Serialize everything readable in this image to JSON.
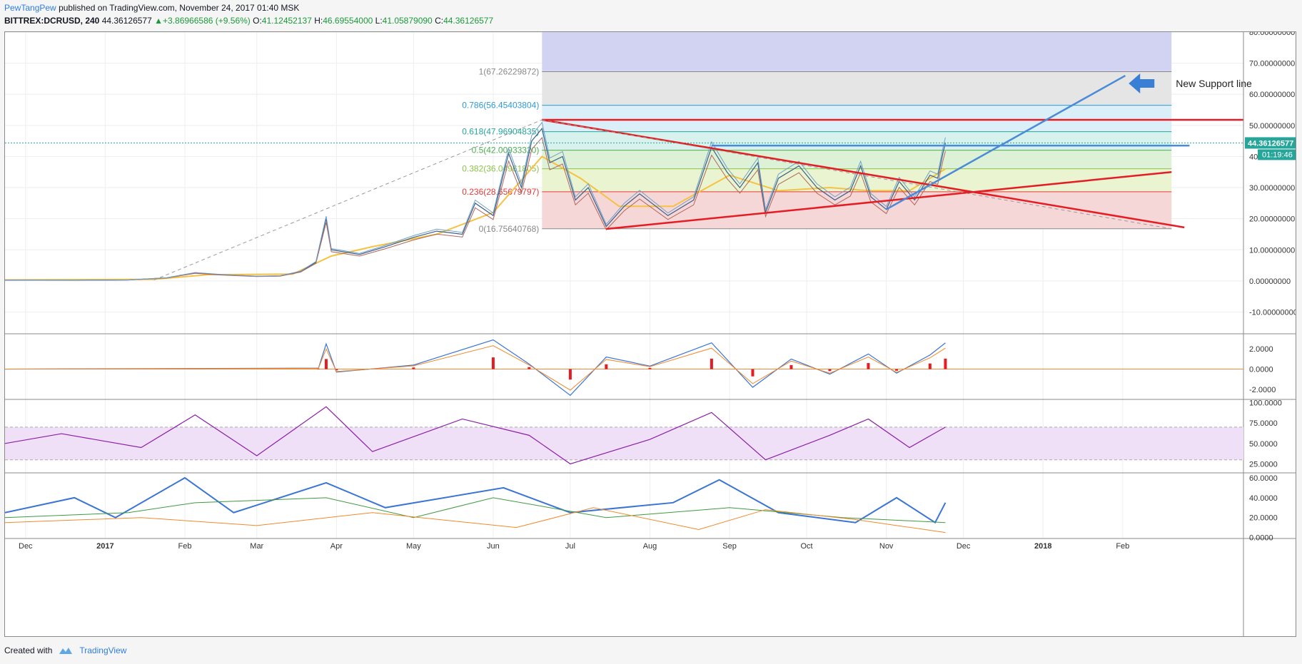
{
  "header": {
    "author": "PewTangPew",
    "published": "published on TradingView.com, November 24, 2017 01:40 MSK"
  },
  "ohlc": {
    "symbol": "BITTREX:DCRUSD, 240",
    "last": "44.36126577",
    "change": "+3.86966586 (+9.56%)",
    "o_label": "O:",
    "o": "41.12452137",
    "h_label": "H:",
    "h": "46.69554000",
    "l_label": "L:",
    "l": "41.05879090",
    "c_label": "C:",
    "c": "44.36126577"
  },
  "footer": {
    "created": "Created with",
    "brand": "TradingView"
  },
  "chart_data": {
    "type": "line",
    "colors": {
      "candles_up": "#6fa0c8",
      "candles_down": "#b0675c",
      "ma_fast": "#f5c242",
      "resistance": "#e51c23",
      "support_new": "#4a8ad8",
      "fib_top": "#6a6ad0"
    },
    "x_axis": {
      "ticks": [
        "Dec",
        "2017",
        "Feb",
        "Mar",
        "Apr",
        "May",
        "Jun",
        "Jul",
        "Aug",
        "Sep",
        "Oct",
        "Nov",
        "Dec",
        "2018",
        "Feb"
      ],
      "tick_dates": [
        "2016-12-01",
        "2017-01-01",
        "2017-02-01",
        "2017-03-01",
        "2017-04-01",
        "2017-05-01",
        "2017-06-01",
        "2017-07-01",
        "2017-08-01",
        "2017-09-01",
        "2017-10-01",
        "2017-11-01",
        "2017-12-01",
        "2018-01-01",
        "2018-02-01"
      ],
      "range": [
        "2016-11-23",
        "2018-03-20"
      ]
    },
    "price_pane": {
      "ylim": [
        -17,
        80
      ],
      "y_ticks": [
        "80.00000000",
        "70.00000000",
        "60.00000000",
        "50.00000000",
        "40.00000000",
        "30.00000000",
        "20.00000000",
        "10.00000000",
        "0.00000000",
        "-10.00000000"
      ],
      "y_tick_values": [
        80,
        70,
        60,
        50,
        40,
        30,
        20,
        10,
        0,
        -10
      ],
      "last_price": 44.36126577,
      "last_price_label": "44.36126577",
      "countdown": "01:19:46",
      "price_series": [
        [
          "2016-11-23",
          0.25
        ],
        [
          "2016-12-20",
          0.2
        ],
        [
          "2017-01-10",
          0.3
        ],
        [
          "2017-01-25",
          1.0
        ],
        [
          "2017-02-05",
          2.6
        ],
        [
          "2017-02-15",
          2.0
        ],
        [
          "2017-03-01",
          1.5
        ],
        [
          "2017-03-10",
          1.6
        ],
        [
          "2017-03-18",
          3.0
        ],
        [
          "2017-03-24",
          6.0
        ],
        [
          "2017-03-28",
          20.0
        ],
        [
          "2017-03-30",
          10.0
        ],
        [
          "2017-04-10",
          8.5
        ],
        [
          "2017-04-20",
          11.0
        ],
        [
          "2017-05-01",
          14.0
        ],
        [
          "2017-05-10",
          16.0
        ],
        [
          "2017-05-20",
          15.0
        ],
        [
          "2017-05-25",
          25.0
        ],
        [
          "2017-06-01",
          21.0
        ],
        [
          "2017-06-07",
          41.0
        ],
        [
          "2017-06-12",
          30.0
        ],
        [
          "2017-06-16",
          45.0
        ],
        [
          "2017-06-20",
          49.0
        ],
        [
          "2017-06-23",
          38.0
        ],
        [
          "2017-06-28",
          40.0
        ],
        [
          "2017-07-03",
          26.0
        ],
        [
          "2017-07-08",
          30.0
        ],
        [
          "2017-07-15",
          17.5
        ],
        [
          "2017-07-22",
          24.0
        ],
        [
          "2017-07-28",
          28.0
        ],
        [
          "2017-08-08",
          21.0
        ],
        [
          "2017-08-18",
          26.0
        ],
        [
          "2017-08-25",
          43.0
        ],
        [
          "2017-08-31",
          35.0
        ],
        [
          "2017-09-05",
          30.0
        ],
        [
          "2017-09-12",
          38.0
        ],
        [
          "2017-09-15",
          22.0
        ],
        [
          "2017-09-20",
          33.0
        ],
        [
          "2017-09-28",
          37.0
        ],
        [
          "2017-10-05",
          30.0
        ],
        [
          "2017-10-12",
          26.0
        ],
        [
          "2017-10-18",
          29.0
        ],
        [
          "2017-10-22",
          37.0
        ],
        [
          "2017-10-26",
          27.0
        ],
        [
          "2017-11-01",
          23.0
        ],
        [
          "2017-11-06",
          32.0
        ],
        [
          "2017-11-12",
          26.0
        ],
        [
          "2017-11-18",
          34.0
        ],
        [
          "2017-11-21",
          33.0
        ],
        [
          "2017-11-23",
          41.0
        ],
        [
          "2017-11-24",
          44.36
        ]
      ],
      "moving_average": [
        [
          "2016-11-23",
          0.3
        ],
        [
          "2017-01-20",
          0.5
        ],
        [
          "2017-02-10",
          2.0
        ],
        [
          "2017-03-15",
          2.2
        ],
        [
          "2017-03-30",
          8.0
        ],
        [
          "2017-04-15",
          11.0
        ],
        [
          "2017-05-10",
          15.0
        ],
        [
          "2017-06-01",
          22.0
        ],
        [
          "2017-06-20",
          40.0
        ],
        [
          "2017-07-05",
          33.0
        ],
        [
          "2017-07-20",
          24.0
        ],
        [
          "2017-08-10",
          24.0
        ],
        [
          "2017-09-01",
          34.0
        ],
        [
          "2017-09-20",
          29.0
        ],
        [
          "2017-10-10",
          30.0
        ],
        [
          "2017-10-25",
          29.0
        ],
        [
          "2017-11-10",
          29.0
        ],
        [
          "2017-11-24",
          36.0
        ]
      ],
      "fibonacci": {
        "start": "2017-06-20",
        "end": "2018-02-20",
        "levels": [
          {
            "label": "1(67.26229872)",
            "value": 67.26229872,
            "color": "#888888"
          },
          {
            "label": "0.786(56.45403804)",
            "value": 56.45403804,
            "color": "#2e9bd6"
          },
          {
            "label": "0.618(47.96904835)",
            "value": 47.96904835,
            "color": "#26a69a"
          },
          {
            "label": "0.5(42.00933320)",
            "value": 42.0093332,
            "color": "#4caf50"
          },
          {
            "label": "0.382(36.04961805)",
            "value": 36.04961805,
            "color": "#8bc34a"
          },
          {
            "label": "0.236(28.65679797)",
            "value": 28.65679797,
            "color": "#e53935"
          },
          {
            "label": "0(16.75640768)",
            "value": 16.75640768,
            "color": "#888888"
          }
        ],
        "zones": [
          {
            "from": 67.26229872,
            "to": 80,
            "color": "#d0d0f2"
          },
          {
            "from": 56.45403804,
            "to": 67.26229872,
            "color": "#e4e4e4"
          },
          {
            "from": 47.96904835,
            "to": 56.45403804,
            "color": "#d8eef8"
          },
          {
            "from": 42.0093332,
            "to": 47.96904835,
            "color": "#d5f1ec"
          },
          {
            "from": 36.04961805,
            "to": 42.0093332,
            "color": "#dbf0d4"
          },
          {
            "from": 28.65679797,
            "to": 36.04961805,
            "color": "#e9f3cf"
          },
          {
            "from": 16.75640768,
            "to": 28.65679797,
            "color": "#f5d5d5"
          }
        ]
      },
      "trendlines": [
        {
          "kind": "horizontal-resistance",
          "color": "#e51c23",
          "from": [
            "2017-06-20",
            51.8
          ],
          "to": [
            "2018-03-20",
            51.8
          ]
        },
        {
          "kind": "descending",
          "color": "#e51c23",
          "from": [
            "2017-06-20",
            51.8
          ],
          "to": [
            "2018-02-25",
            17.2
          ]
        },
        {
          "kind": "ascending-support",
          "color": "#e51c23",
          "from": [
            "2017-07-15",
            16.7
          ],
          "to": [
            "2018-02-20",
            35.0
          ]
        },
        {
          "kind": "new-support",
          "color": "#4a8ad8",
          "from": [
            "2017-11-01",
            23.0
          ],
          "to": [
            "2018-02-02",
            66.0
          ]
        },
        {
          "kind": "blue-horizontal",
          "color": "#4a8ad8",
          "from": [
            "2017-08-25",
            43.5
          ],
          "to": [
            "2018-02-27",
            43.5
          ]
        },
        {
          "kind": "dashed-grey",
          "color": "#999999",
          "from": [
            "2017-01-20",
            0.3
          ],
          "to": [
            "2017-06-20",
            51.8
          ]
        },
        {
          "kind": "dashed-grey",
          "color": "#999999",
          "from": [
            "2017-06-20",
            51.8
          ],
          "to": [
            "2018-02-20",
            16.75
          ]
        }
      ],
      "annotation": {
        "text": "New Support line",
        "arrow_at": [
          "2018-02-05",
          63.5
        ]
      }
    },
    "macd_pane": {
      "ylim": [
        -3,
        3.5
      ],
      "y_ticks": [
        "2.0000",
        "0.0000",
        "-2.0000"
      ],
      "y_tick_values": [
        2,
        0,
        -2
      ],
      "series": [
        [
          "2016-11-23",
          0.0
        ],
        [
          "2017-03-25",
          0.1
        ],
        [
          "2017-03-28",
          2.5
        ],
        [
          "2017-04-01",
          -0.3
        ],
        [
          "2017-05-01",
          0.4
        ],
        [
          "2017-06-01",
          2.9
        ],
        [
          "2017-06-15",
          0.5
        ],
        [
          "2017-07-01",
          -2.6
        ],
        [
          "2017-07-15",
          1.2
        ],
        [
          "2017-08-01",
          0.3
        ],
        [
          "2017-08-25",
          2.6
        ],
        [
          "2017-09-10",
          -1.8
        ],
        [
          "2017-09-25",
          1.0
        ],
        [
          "2017-10-10",
          -0.5
        ],
        [
          "2017-10-25",
          1.5
        ],
        [
          "2017-11-05",
          -0.4
        ],
        [
          "2017-11-18",
          1.4
        ],
        [
          "2017-11-24",
          2.6
        ]
      ]
    },
    "rsi_pane": {
      "ylim": [
        14,
        104
      ],
      "y_ticks": [
        "100.0000",
        "75.0000",
        "50.0000",
        "25.0000"
      ],
      "y_tick_values": [
        100,
        75,
        50,
        25
      ],
      "band": [
        30,
        70
      ],
      "series": [
        [
          "2016-11-23",
          50
        ],
        [
          "2016-12-15",
          62
        ],
        [
          "2017-01-15",
          45
        ],
        [
          "2017-02-05",
          85
        ],
        [
          "2017-03-01",
          35
        ],
        [
          "2017-03-28",
          95
        ],
        [
          "2017-04-15",
          40
        ],
        [
          "2017-05-20",
          80
        ],
        [
          "2017-06-15",
          60
        ],
        [
          "2017-07-01",
          25
        ],
        [
          "2017-08-01",
          55
        ],
        [
          "2017-08-25",
          88
        ],
        [
          "2017-09-15",
          30
        ],
        [
          "2017-10-10",
          60
        ],
        [
          "2017-10-25",
          80
        ],
        [
          "2017-11-10",
          45
        ],
        [
          "2017-11-24",
          70
        ]
      ]
    },
    "dmi_pane": {
      "ylim": [
        -1,
        65
      ],
      "y_ticks": [
        "60.0000",
        "40.0000",
        "20.0000",
        "0.0000"
      ],
      "y_tick_values": [
        60,
        40,
        20,
        0
      ],
      "series": [
        {
          "color": "#3a74d4",
          "points": [
            [
              "2016-11-23",
              25
            ],
            [
              "2016-12-20",
              40
            ],
            [
              "2017-01-05",
              20
            ],
            [
              "2017-02-01",
              60
            ],
            [
              "2017-02-20",
              25
            ],
            [
              "2017-03-28",
              55
            ],
            [
              "2017-04-20",
              30
            ],
            [
              "2017-06-05",
              50
            ],
            [
              "2017-07-01",
              25
            ],
            [
              "2017-08-10",
              35
            ],
            [
              "2017-08-28",
              58
            ],
            [
              "2017-09-20",
              25
            ],
            [
              "2017-10-20",
              15
            ],
            [
              "2017-11-05",
              40
            ],
            [
              "2017-11-20",
              15
            ],
            [
              "2017-11-24",
              35
            ]
          ]
        },
        {
          "color": "#3f9a3f",
          "points": [
            [
              "2016-11-23",
              20
            ],
            [
              "2017-01-10",
              25
            ],
            [
              "2017-02-05",
              35
            ],
            [
              "2017-03-28",
              40
            ],
            [
              "2017-05-01",
              20
            ],
            [
              "2017-06-01",
              40
            ],
            [
              "2017-07-15",
              20
            ],
            [
              "2017-09-01",
              30
            ],
            [
              "2017-10-15",
              20
            ],
            [
              "2017-11-24",
              15
            ]
          ]
        },
        {
          "color": "#f0892b",
          "points": [
            [
              "2016-11-23",
              15
            ],
            [
              "2017-01-15",
              20
            ],
            [
              "2017-03-01",
              12
            ],
            [
              "2017-04-15",
              25
            ],
            [
              "2017-06-10",
              10
            ],
            [
              "2017-07-10",
              30
            ],
            [
              "2017-08-20",
              8
            ],
            [
              "2017-09-15",
              28
            ],
            [
              "2017-10-20",
              18
            ],
            [
              "2017-11-24",
              5
            ]
          ]
        }
      ]
    }
  }
}
